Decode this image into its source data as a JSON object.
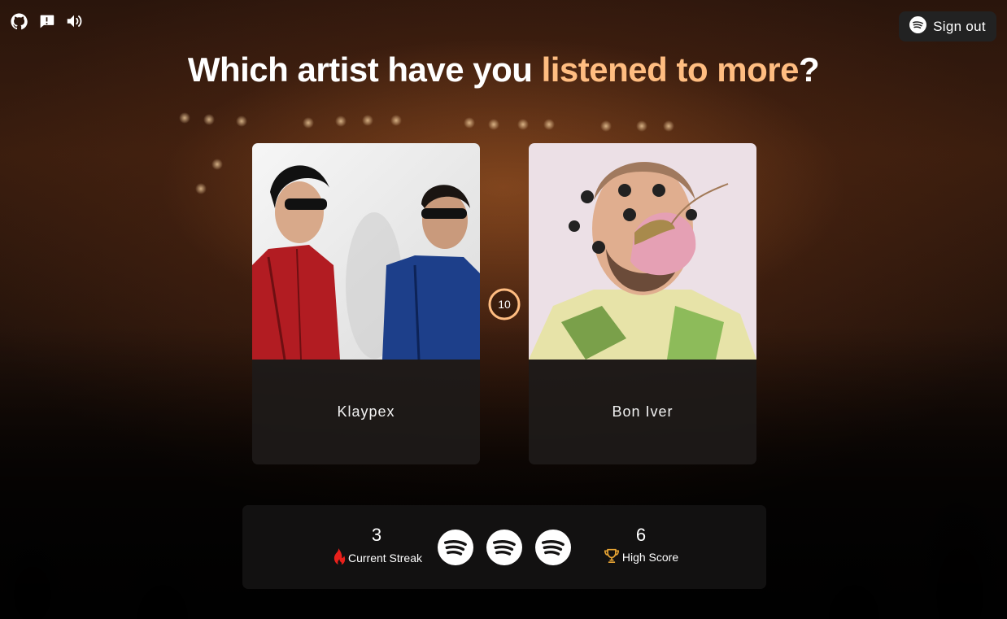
{
  "top_icons": [
    "github-icon",
    "feedback-icon",
    "volume-icon"
  ],
  "signout": {
    "label": "Sign out",
    "icon": "spotify-icon"
  },
  "title": {
    "prefix": "Which artist have you ",
    "accent": "listened to more",
    "suffix": "?"
  },
  "cards": [
    {
      "name": "Klaypex"
    },
    {
      "name": "Bon Iver"
    }
  ],
  "timer": {
    "value": "10"
  },
  "score": {
    "current_streak": "3",
    "current_streak_label": "Current Streak",
    "high_score": "6",
    "high_score_label": "High Score",
    "lives": [
      "spotify-icon",
      "spotify-icon",
      "spotify-icon"
    ]
  },
  "colors": {
    "accent": "#ffbd81",
    "panel": "#141313",
    "spotify": "#ffffff"
  }
}
